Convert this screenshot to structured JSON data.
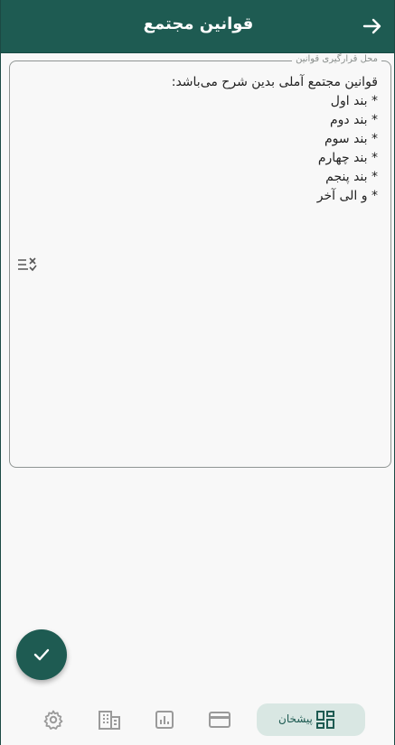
{
  "appbar": {
    "title": "قوانین مجتمع",
    "back_icon": "arrow-forward-icon"
  },
  "rules_field": {
    "label": "محل قرارگیری قوانین",
    "lines": [
      "قوانین مجتمع آملی بدین شرح می‌باشد:",
      "* بند اول",
      "* بند دوم",
      "* بند سوم",
      "* بند چهارم",
      "* بند پنجم",
      "* و الی آخر"
    ],
    "clear_icon": "clear-list-icon"
  },
  "fab": {
    "icon": "check-icon"
  },
  "bottom_nav": {
    "active_label": "پیشخان",
    "items": [
      {
        "icon": "dashboard-icon",
        "active": true
      },
      {
        "icon": "credit-card-icon",
        "active": false
      },
      {
        "icon": "chart-icon",
        "active": false
      },
      {
        "icon": "building-icon",
        "active": false
      },
      {
        "icon": "gear-icon",
        "active": false
      }
    ]
  },
  "colors": {
    "primary": "#1e5b52",
    "active_nav_bg": "#d9e7e3",
    "inactive_icon": "#9a9a9a"
  }
}
